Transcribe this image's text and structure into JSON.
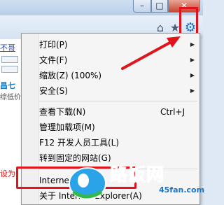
{
  "window": {
    "minimize_glyph": "–",
    "maximize_glyph": "□",
    "close_glyph": "✕"
  },
  "toolbar": {
    "home_icon": "home-icon",
    "favorites_icon": "star-icon",
    "tools_icon": "gear-icon"
  },
  "page": {
    "link_partial": "不哥",
    "blue_partial": "昌七",
    "small_partial": "综低价",
    "red_partial": "设为"
  },
  "menu": {
    "items": [
      {
        "label": "打印(P)",
        "submenu": true
      },
      {
        "label": "文件(F)",
        "submenu": true
      },
      {
        "label": "缩放(Z) (100%)",
        "submenu": true
      },
      {
        "label": "安全(S)",
        "submenu": true
      },
      {
        "label": "查看下载(N)",
        "shortcut": "Ctrl+J"
      },
      {
        "label": "管理加载项(M)"
      },
      {
        "label": "F12 开发人员工具(L)"
      },
      {
        "label": "转到固定的网站(G)"
      },
      {
        "label": "Internet 选项(O)"
      },
      {
        "label": "关于 Internet Explorer(A)"
      }
    ],
    "submenu_arrow": "▶"
  },
  "watermark": {
    "text": "路饭网",
    "url": "45fan.com"
  },
  "colors": {
    "highlight_red": "#e0141c",
    "gear_blue": "#1d6fc2"
  }
}
